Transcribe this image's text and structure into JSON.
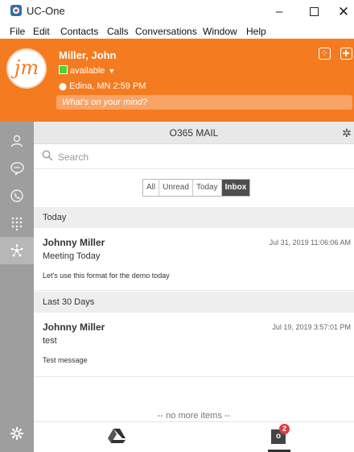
{
  "window": {
    "title": "UC-One"
  },
  "menu": [
    "File",
    "Edit",
    "Contacts",
    "Calls",
    "Conversations",
    "Window",
    "Help"
  ],
  "profile": {
    "initials": "jm",
    "name": "Miller, John",
    "status": "available",
    "location": "Edina, MN 2:59 PM",
    "mind_placeholder": "What's on your mind?"
  },
  "mail": {
    "title": "O365 MAIL",
    "search_placeholder": "Search",
    "filters": [
      "All",
      "Unread",
      "Today",
      "Inbox"
    ],
    "active_filter": "Inbox",
    "sections": [
      {
        "label": "Today",
        "messages": [
          {
            "sender": "Johnny Miller",
            "date": "Jul 31, 2019 11:06:06 AM",
            "subject": "Meeting Today",
            "preview": "Let's use this format for the demo today"
          }
        ]
      },
      {
        "label": "Last 30 Days",
        "messages": [
          {
            "sender": "Johnny Miller",
            "date": "Jul 19, 2019 3:57:01 PM",
            "subject": "test",
            "preview": "Test message"
          }
        ]
      }
    ],
    "no_more": "-- no more items --"
  },
  "bottom": {
    "outlook_letter": "o",
    "outlook_badge": "2"
  },
  "colors": {
    "accent": "#f47b20",
    "rail": "#9e9e9e",
    "status": "#4cd137",
    "badge": "#e13b3b"
  }
}
